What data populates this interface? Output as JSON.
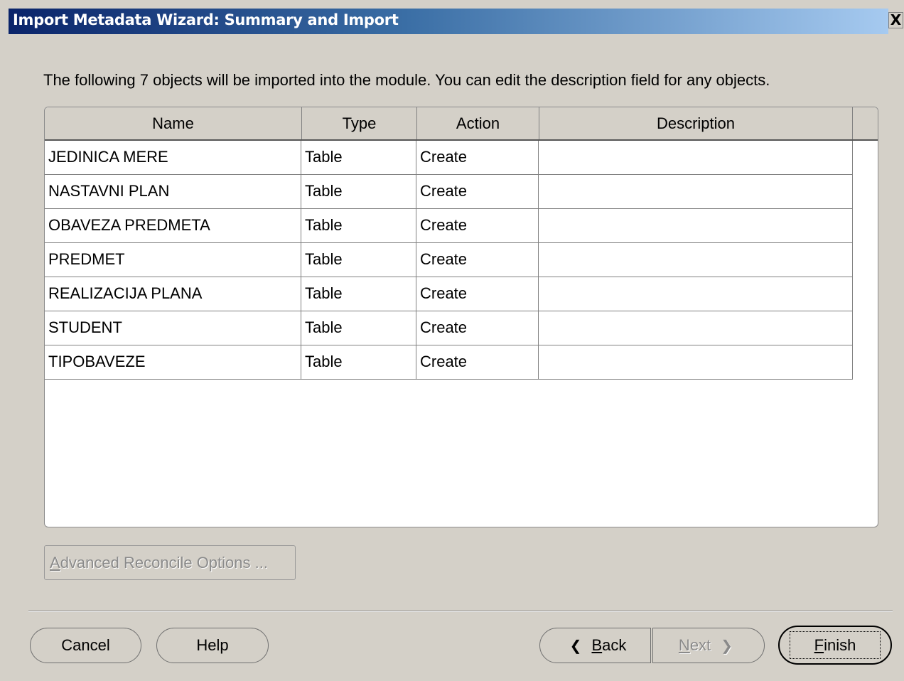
{
  "window": {
    "title": "Import Metadata Wizard: Summary and Import",
    "close_label": "X"
  },
  "intro_text": "The following 7 objects will be imported into the module. You can edit the description field for any objects.",
  "table": {
    "columns": [
      "Name",
      "Type",
      "Action",
      "Description"
    ],
    "rows": [
      [
        "JEDINICA MERE",
        "Table",
        "Create",
        ""
      ],
      [
        "NASTAVNI PLAN",
        "Table",
        "Create",
        ""
      ],
      [
        "OBAVEZA PREDMETA",
        "Table",
        "Create",
        ""
      ],
      [
        "PREDMET",
        "Table",
        "Create",
        ""
      ],
      [
        "REALIZACIJA PLANA",
        "Table",
        "Create",
        ""
      ],
      [
        "STUDENT",
        "Table",
        "Create",
        ""
      ],
      [
        "TIPOBAVEZE",
        "Table",
        "Create",
        ""
      ]
    ]
  },
  "buttons": {
    "advanced_first": "A",
    "advanced_rest": "dvanced Reconcile Options ...",
    "cancel": "Cancel",
    "help": "Help",
    "back_first": "B",
    "back_rest": "ack",
    "next_first": "N",
    "next_rest": "ext",
    "finish_first": "F",
    "finish_rest": "inish"
  },
  "icons": {
    "back": "chevron-left-icon",
    "next": "chevron-right-icon",
    "close": "close-icon"
  },
  "colors": {
    "title_gradient_start": "#0a246a",
    "title_gradient_end": "#a6caf0",
    "dialog_bg": "#d4d0c8"
  }
}
